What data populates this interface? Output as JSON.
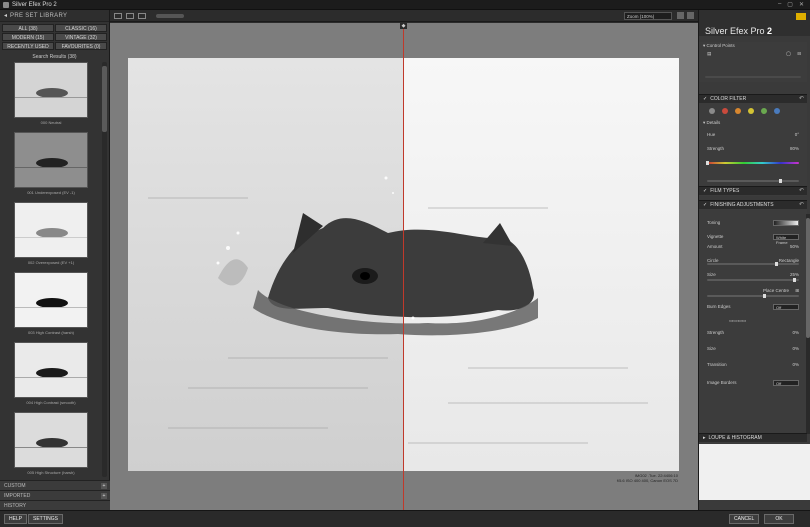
{
  "window": {
    "title": "Silver Efex Pro 2",
    "controls": [
      "–",
      "▢",
      "✕"
    ]
  },
  "left_panel": {
    "header": "PRE SET LIBRARY",
    "tabs": [
      "ALL (38)",
      "CLASSIC (16)",
      "MODERN (15)",
      "VINTAGE (32)",
      "RECENTLY USED",
      "FAVOURITES (0)"
    ],
    "search_results": "Search Results (38)",
    "thumbnails": [
      "000 Neutral",
      "001 Underexposed (EV -1)",
      "002 Overexposed (EV +1)",
      "003 High Contrast (harsh)",
      "004 High Contrast (smooth)",
      "005 High Structure (harsh)"
    ],
    "sections": [
      "CUSTOM",
      "IMPORTED",
      "HISTORY"
    ]
  },
  "toolbar": {
    "zoom": "Zoom (100%)"
  },
  "canvas": {
    "meta_line1": "IMG02 .Tue. 22:4406:10",
    "meta_line2": "f/5.6 ISO 400 400, Canon EOS 7D"
  },
  "right_panel": {
    "product": "Silver Efex Pro",
    "version": "2",
    "control_points": "Control Points",
    "color_filter": {
      "title": "COLOR FILTER",
      "colors": [
        "#8a8a8a",
        "#c94a3c",
        "#d8872f",
        "#d3c334",
        "#6aa84f",
        "#4a7bbd"
      ],
      "details": "Details",
      "hue_label": "Hue",
      "hue_value": "0°",
      "hue_fraction": 0.0,
      "strength_label": "Strength",
      "strength_value": "80%",
      "strength_fraction": 0.8
    },
    "film_types": "FILM TYPES",
    "finishing": {
      "title": "FINISHING ADJUSTMENTS",
      "toning": "Toning",
      "vignette": "Vignette",
      "vignette_select": "White Frame",
      "amount_label": "Amount",
      "amount_value": "50%",
      "amount_fraction": 0.75,
      "circle_label": "Circle",
      "rect_label": "Rectangle",
      "shape_fraction": 0.95,
      "size_label": "Size",
      "size_value": "25%",
      "size_fraction": 0.62,
      "place_centre": "Place Centre",
      "burn_edges": "Burn Edges",
      "burn_select": "Off",
      "b_strength_label": "Strength",
      "b_strength_value": "0%",
      "b_size_label": "Size",
      "b_size_value": "0%",
      "b_transition_label": "Transition",
      "b_transition_value": "0%",
      "image_borders": "Image Borders",
      "borders_select": "Off"
    },
    "loupe": "LOUPE & HISTOGRAM"
  },
  "bottom": {
    "help": "HELP",
    "settings": "SETTINGS",
    "cancel": "CANCEL",
    "ok": "OK"
  }
}
